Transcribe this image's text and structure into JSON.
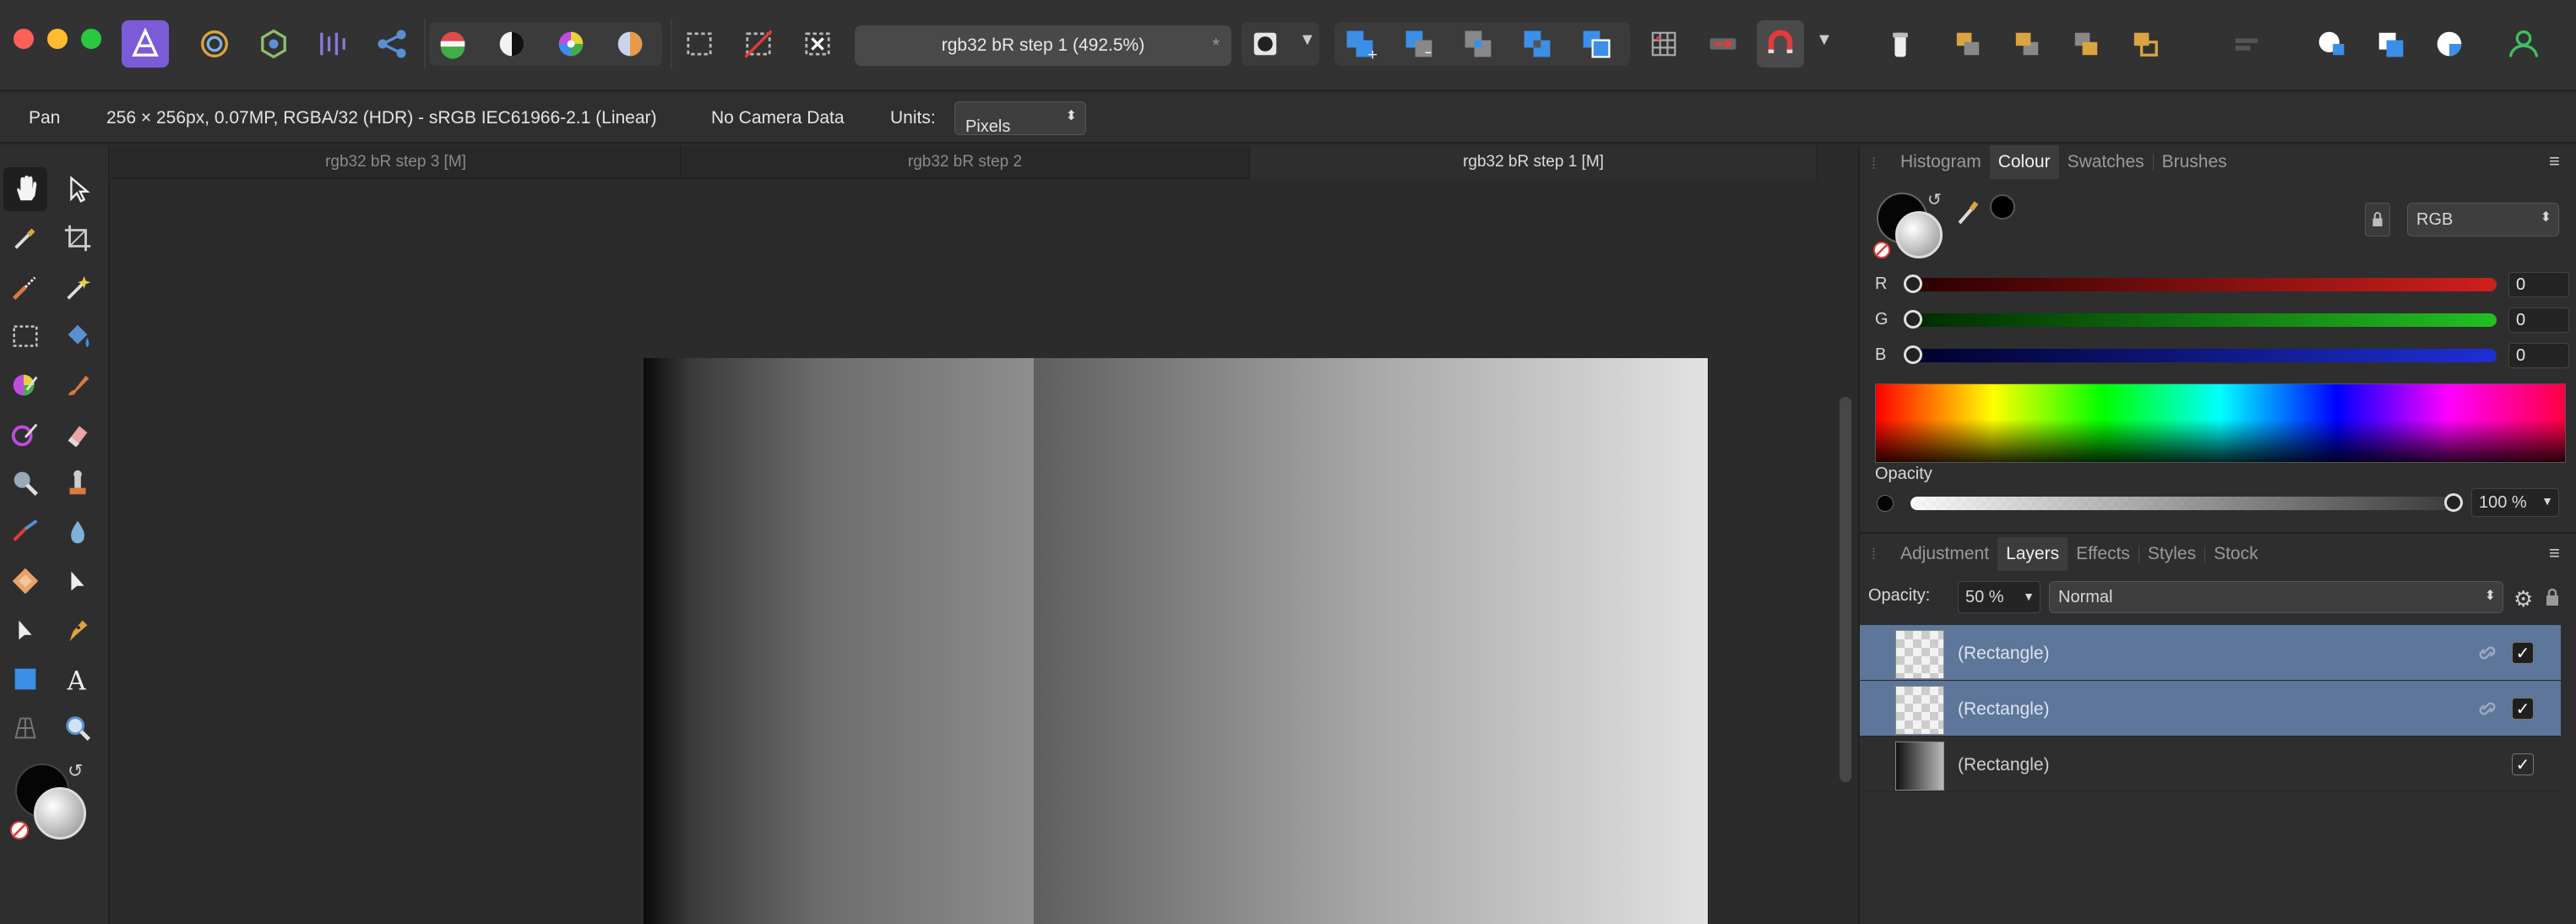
{
  "toolbar": {
    "document_title": "rgb32 bR step 1 (492.5%)",
    "unsaved_mark": "*",
    "accent_color": "#7b5bd6"
  },
  "context": {
    "tool_name": "Pan",
    "document_info": "256 × 256px, 0.07MP, RGBA/32 (HDR) - sRGB IEC61966-2.1 (Linear)",
    "camera": "No Camera Data",
    "units_label": "Units:",
    "units_value": "Pixels"
  },
  "doc_tabs": [
    {
      "label": "rgb32 bR step 3 [M]"
    },
    {
      "label": "rgb32 bR step 2"
    },
    {
      "label": "rgb32 bR step 1 [M]"
    }
  ],
  "top_panel": {
    "tabs": [
      {
        "label": "Histogram"
      },
      {
        "label": "Colour"
      },
      {
        "label": "Swatches"
      },
      {
        "label": "Brushes"
      }
    ],
    "active_tab": "Colour",
    "colour_model": "RGB",
    "channels": [
      {
        "label": "R",
        "value": "0",
        "color": "#d11e1e"
      },
      {
        "label": "G",
        "value": "0",
        "color": "#22a822"
      },
      {
        "label": "B",
        "value": "0",
        "color": "#1e2fd6"
      }
    ],
    "opacity_label": "Opacity",
    "opacity_value": "100 %"
  },
  "bottom_panel": {
    "tabs": [
      {
        "label": "Adjustment"
      },
      {
        "label": "Layers"
      },
      {
        "label": "Effects"
      },
      {
        "label": "Styles"
      },
      {
        "label": "Stock"
      }
    ],
    "active_tab": "Layers",
    "opacity_label": "Opacity:",
    "opacity_value": "50 %",
    "blend_mode": "Normal",
    "layers": [
      {
        "name": "(Rectangle)",
        "selected": true,
        "visible": true
      },
      {
        "name": "(Rectangle)",
        "selected": true,
        "visible": true
      },
      {
        "name": "(Rectangle)",
        "selected": false,
        "visible": true
      }
    ],
    "check_mark": "✓"
  }
}
